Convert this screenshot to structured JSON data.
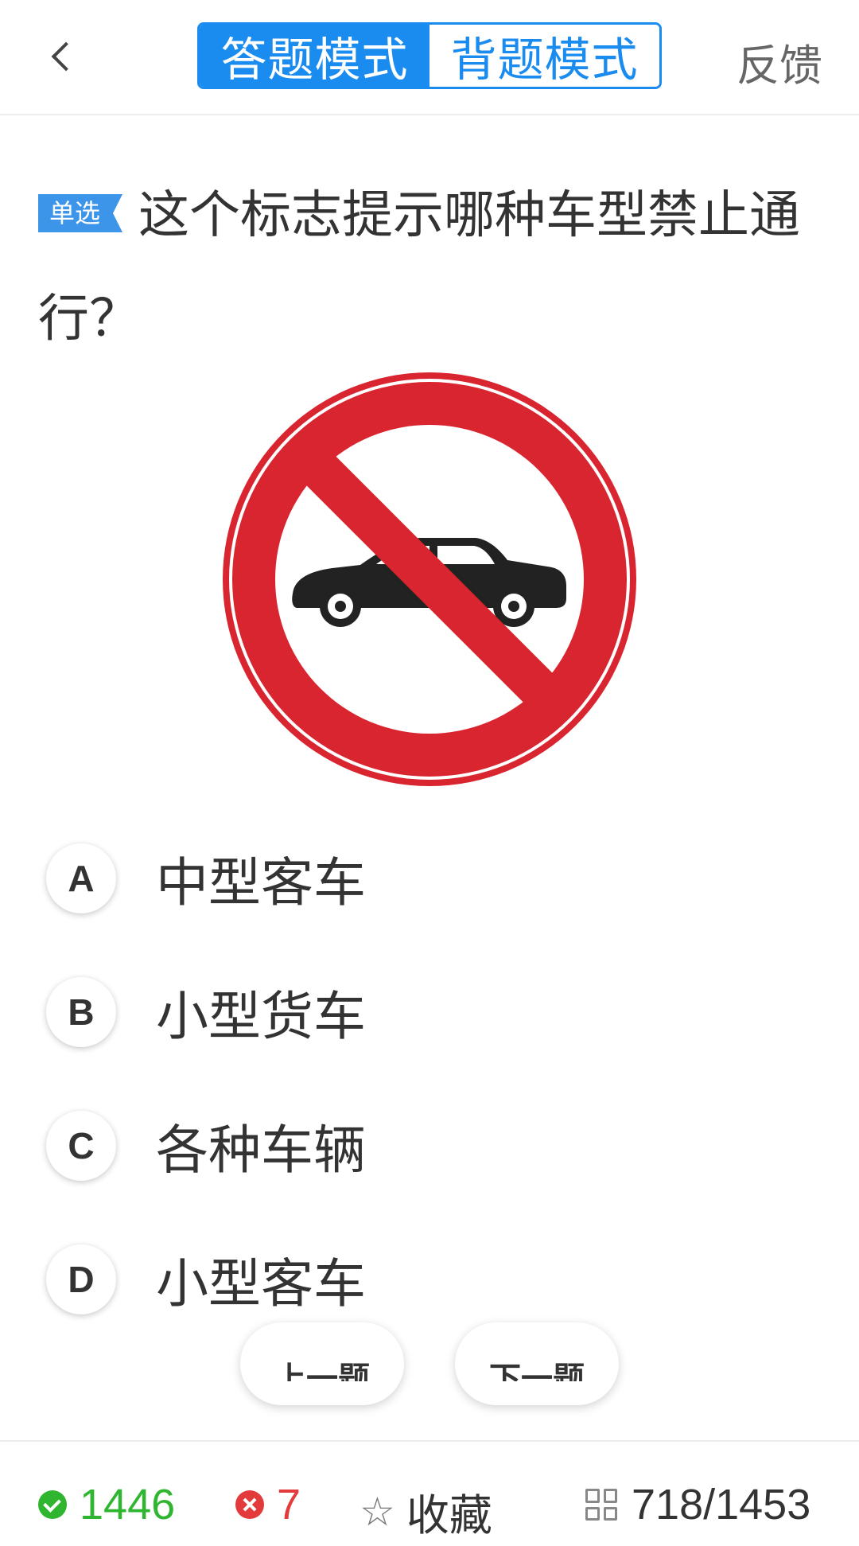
{
  "header": {
    "tabs": [
      {
        "label": "答题模式",
        "active": true
      },
      {
        "label": "背题模式",
        "active": false
      }
    ],
    "feedback": "反馈"
  },
  "question": {
    "type_badge": "单选",
    "text": "这个标志提示哪种车型禁止通行？",
    "image": "no-cars-sign"
  },
  "options": [
    {
      "letter": "A",
      "text": "中型客车"
    },
    {
      "letter": "B",
      "text": "小型货车"
    },
    {
      "letter": "C",
      "text": "各种车辆"
    },
    {
      "letter": "D",
      "text": "小型客车"
    }
  ],
  "nav": {
    "prev": "上一题",
    "next": "下一题"
  },
  "bottom": {
    "correct_count": "1446",
    "wrong_count": "7",
    "favorite_label": "收藏",
    "progress": "718/1453"
  },
  "colors": {
    "accent": "#1a8cf0",
    "correct": "#2fb52f",
    "wrong": "#e33b3b",
    "sign_red": "#d9252f"
  }
}
